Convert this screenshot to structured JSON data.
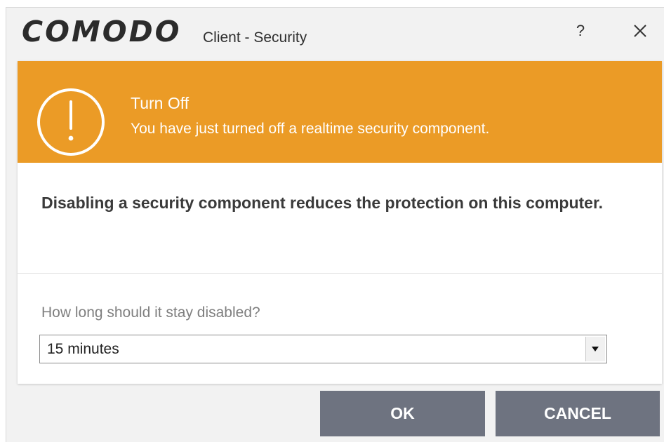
{
  "window": {
    "brand": "COMODO",
    "title": "Client - Security",
    "help_label": "?",
    "background_color": "#f2f2f2"
  },
  "banner": {
    "title": "Turn Off",
    "subtitle": "You have just turned off a realtime security component.",
    "color": "#eb9b26",
    "icon": "exclamation-circle-icon"
  },
  "message": "Disabling a security component reduces the protection on this computer.",
  "duration": {
    "question": "How long should it stay disabled?",
    "selected": "15 minutes"
  },
  "buttons": {
    "ok": "OK",
    "cancel": "CANCEL",
    "color": "#6e7380"
  },
  "icons": {
    "close": "close-icon",
    "dropdown": "chevron-down-icon"
  }
}
